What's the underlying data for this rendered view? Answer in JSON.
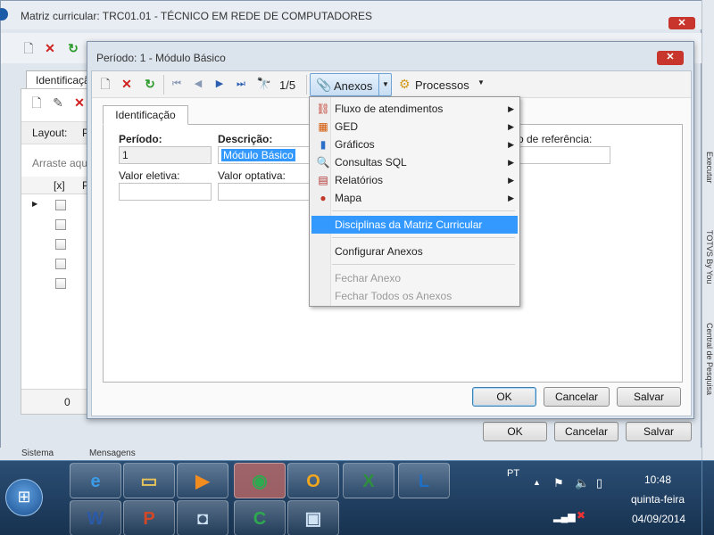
{
  "outer_window": {
    "title": "Matriz curricular: TRC01.01 - TÉCNICO EM REDE DE COMPUTADORES",
    "tab_partial": "Identificaçã",
    "layout_label": "Layout:",
    "layout_partial": "P",
    "drag_hint": "Arraste aqui",
    "grid_col_x": "[x]",
    "grid_col_p": "P",
    "footer_count": "0",
    "ok_label": "OK",
    "cancel_label": "Cancelar",
    "save_label": "Salvar",
    "status_sistema": "Sistema",
    "status_mensagens": "Mensagens"
  },
  "dialog": {
    "title": "Período: 1 - Módulo Básico",
    "record_counter": "1/5",
    "anexos_label": "Anexos",
    "processos_label": "Processos",
    "tab_identificacao": "Identificação",
    "periodo_label": "Período:",
    "periodo_value": "1",
    "descricao_label": "Descrição:",
    "descricao_value": "Módulo Básico",
    "referencia_label": "o de referência:",
    "valor_eletiva_label": "Valor eletiva:",
    "valor_optativa_label": "Valor optativa:",
    "ok_label": "OK",
    "cancel_label": "Cancelar",
    "save_label": "Salvar"
  },
  "anexos_menu": {
    "items": [
      {
        "label": "Fluxo de atendimentos",
        "icon": "flow-icon"
      },
      {
        "label": "GED",
        "icon": "ged-icon"
      },
      {
        "label": "Gráficos",
        "icon": "chart-icon"
      },
      {
        "label": "Consultas SQL",
        "icon": "sql-search-icon"
      },
      {
        "label": "Relatórios",
        "icon": "report-icon"
      },
      {
        "label": "Mapa",
        "icon": "map-pin-icon"
      },
      {
        "label": "Disciplinas da Matriz Curricular"
      },
      {
        "label": "Configurar Anexos"
      },
      {
        "label": "Fechar Anexo"
      },
      {
        "label": "Fechar Todos os Anexos"
      }
    ]
  },
  "right_panel": {
    "executar": "Executar",
    "totvs": "TOTVS By You",
    "central": "Central de Pesquisa"
  },
  "taskbar": {
    "lang": "PT",
    "time": "10:48",
    "day": "quinta-feira",
    "date": "04/09/2014"
  },
  "colors": {
    "accent": "#3399ff",
    "close_red": "#c7352c",
    "taskbar": "#1f3c5e"
  }
}
